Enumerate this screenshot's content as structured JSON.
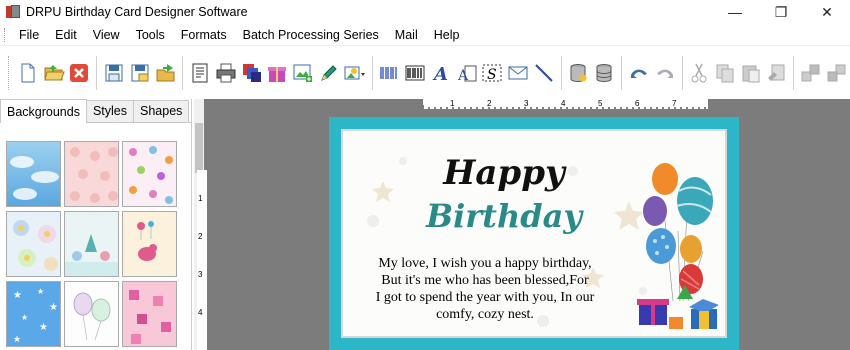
{
  "app": {
    "title": "DRPU Birthday Card Designer Software",
    "window_controls": {
      "minimize": "—",
      "maximize": "❐",
      "close": "✕"
    }
  },
  "menu": [
    "File",
    "Edit",
    "View",
    "Tools",
    "Formats",
    "Batch Processing Series",
    "Mail",
    "Help"
  ],
  "toolbar": {
    "icons": [
      "new-document-icon",
      "open-folder-icon",
      "close-icon",
      "save-icon",
      "save-as-icon",
      "export-icon",
      "properties-icon",
      "print-icon",
      "copy-pages-icon",
      "gift-icon",
      "insert-image-icon",
      "pencil-icon",
      "picture-dropdown-icon",
      "barcode-icon",
      "barcode2-icon",
      "text-icon",
      "wordart-icon",
      "signature-icon",
      "envelope-icon",
      "line-icon",
      "database-icon",
      "database2-icon",
      "undo-icon",
      "redo-icon",
      "cut-icon",
      "copy-icon",
      "paste-icon",
      "delete-icon",
      "bring-forward-icon",
      "send-backward-icon"
    ]
  },
  "left_panel": {
    "tabs": [
      {
        "label": "Backgrounds",
        "active": true
      },
      {
        "label": "Styles",
        "active": false
      },
      {
        "label": "Shapes",
        "active": false
      }
    ],
    "thumbnails": [
      "sky-clouds",
      "pink-pattern",
      "butterflies",
      "pastel-flowers",
      "winter-scene",
      "pink-bird",
      "blue-stars",
      "balloons-outline",
      "pink-presents"
    ]
  },
  "rulers": {
    "horizontal": [
      "1",
      "2",
      "3",
      "4",
      "5",
      "6",
      "7"
    ],
    "vertical": [
      "1",
      "2",
      "3",
      "4"
    ]
  },
  "card": {
    "title_line1": "Happy",
    "title_line2": "Birthday",
    "message": [
      "My love, I wish you a happy birthday,",
      "But it's me who has been blessed,For",
      "I got to spend the year with you, In our",
      "comfy, cozy nest."
    ],
    "border_color": "#2db6c8",
    "title2_color": "#2a8a8a"
  },
  "colors": {
    "workspace": "#7c7c7c",
    "accent": "#2db6c8"
  }
}
